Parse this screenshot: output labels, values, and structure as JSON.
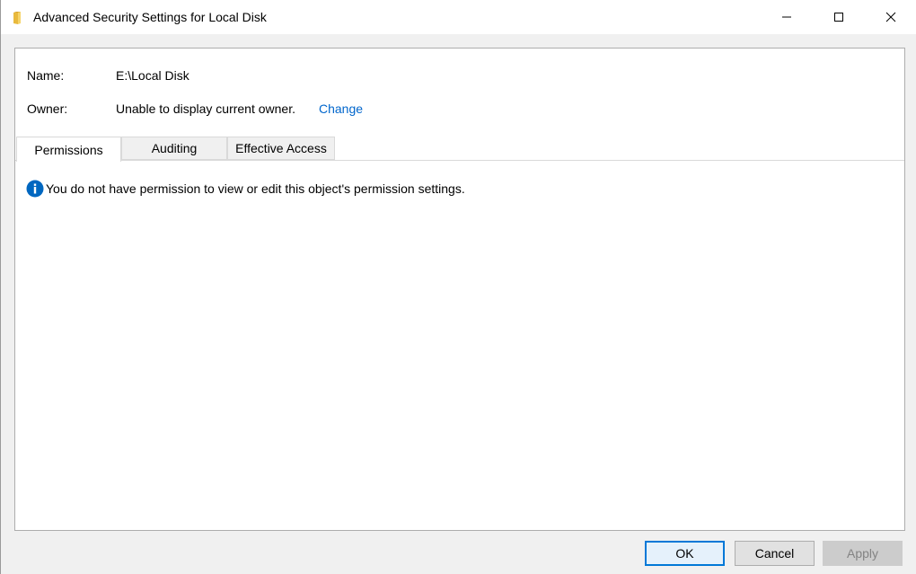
{
  "window": {
    "title": "Advanced Security Settings for Local Disk",
    "icon": "folder-icon"
  },
  "fields": {
    "name_label": "Name:",
    "name_value": "E:\\Local Disk",
    "owner_label": "Owner:",
    "owner_value": "Unable to display current owner.",
    "owner_change_link": "Change"
  },
  "tabs": [
    {
      "label": "Permissions",
      "active": true
    },
    {
      "label": "Auditing",
      "active": false
    },
    {
      "label": "Effective Access",
      "active": false
    }
  ],
  "message": {
    "icon": "info-icon",
    "text": "You do not have permission to view or edit this object's permission settings."
  },
  "buttons": {
    "ok": "OK",
    "cancel": "Cancel",
    "apply": "Apply"
  },
  "colors": {
    "link": "#0066cc",
    "info_icon": "#0067c0",
    "default_button_border": "#0078d7"
  }
}
